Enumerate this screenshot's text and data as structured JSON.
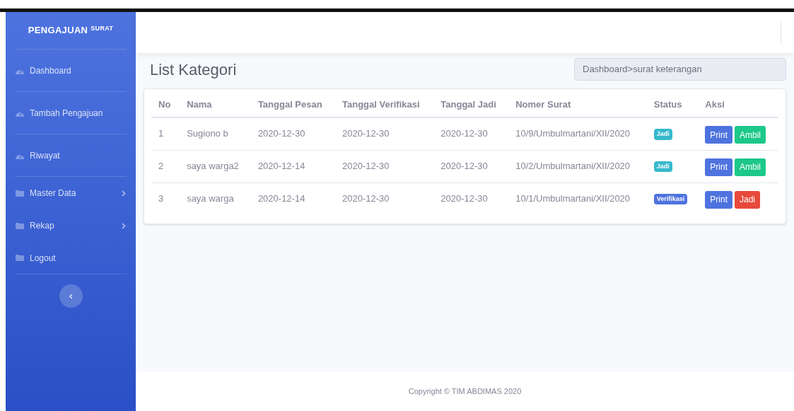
{
  "sidebar": {
    "brand": "PENGAJUAN",
    "brand_sup": "SURAT",
    "items": [
      {
        "label": "Dashboard",
        "kind": "gauge",
        "has_submenu": false,
        "divider_after": true
      },
      {
        "label": "Tambah Pengajuan",
        "kind": "gauge",
        "has_submenu": false,
        "divider_after": true
      },
      {
        "label": "Riwayat",
        "kind": "gauge",
        "has_submenu": false,
        "divider_after": true
      },
      {
        "label": "Master Data",
        "kind": "folder",
        "has_submenu": true,
        "divider_after": false
      },
      {
        "label": "Rekap",
        "kind": "folder",
        "has_submenu": true,
        "divider_after": false
      },
      {
        "label": "Logout",
        "kind": "folder",
        "has_submenu": false,
        "divider_after": true
      }
    ]
  },
  "page": {
    "title": "List Kategori",
    "breadcrumb": "Dashboard>surat keterangan"
  },
  "table": {
    "columns": [
      "No",
      "Nama",
      "Tanggal Pesan",
      "Tanggal Verifikasi",
      "Tanggal Jadi",
      "Nomer Surat",
      "Status",
      "Aksi"
    ],
    "rows": [
      {
        "no": "1",
        "nama": "Sugiono b",
        "pesan": "2020-12-30",
        "verifikasi": "2020-12-30",
        "jadi": "2020-12-30",
        "nomer": "10/9/Umbulmartani/XII/2020",
        "status": {
          "label": "Jadi",
          "kind": "info"
        },
        "actions": [
          {
            "label": "Print",
            "kind": "primary"
          },
          {
            "label": "Ambil",
            "kind": "success"
          }
        ]
      },
      {
        "no": "2",
        "nama": "saya warga2",
        "pesan": "2020-12-14",
        "verifikasi": "2020-12-30",
        "jadi": "2020-12-30",
        "nomer": "10/2/Umbulmartani/XII/2020",
        "status": {
          "label": "Jadi",
          "kind": "info"
        },
        "actions": [
          {
            "label": "Print",
            "kind": "primary"
          },
          {
            "label": "Ambil",
            "kind": "success"
          }
        ]
      },
      {
        "no": "3",
        "nama": "saya warga",
        "pesan": "2020-12-14",
        "verifikasi": "2020-12-30",
        "jadi": "2020-12-30",
        "nomer": "10/1/Umbulmartani/XII/2020",
        "status": {
          "label": "Verifikasi",
          "kind": "primary"
        },
        "actions": [
          {
            "label": "Print",
            "kind": "primary"
          },
          {
            "label": "Jadi",
            "kind": "danger"
          }
        ]
      }
    ]
  },
  "footer": "Copyright © TIM ABDIMAS 2020"
}
